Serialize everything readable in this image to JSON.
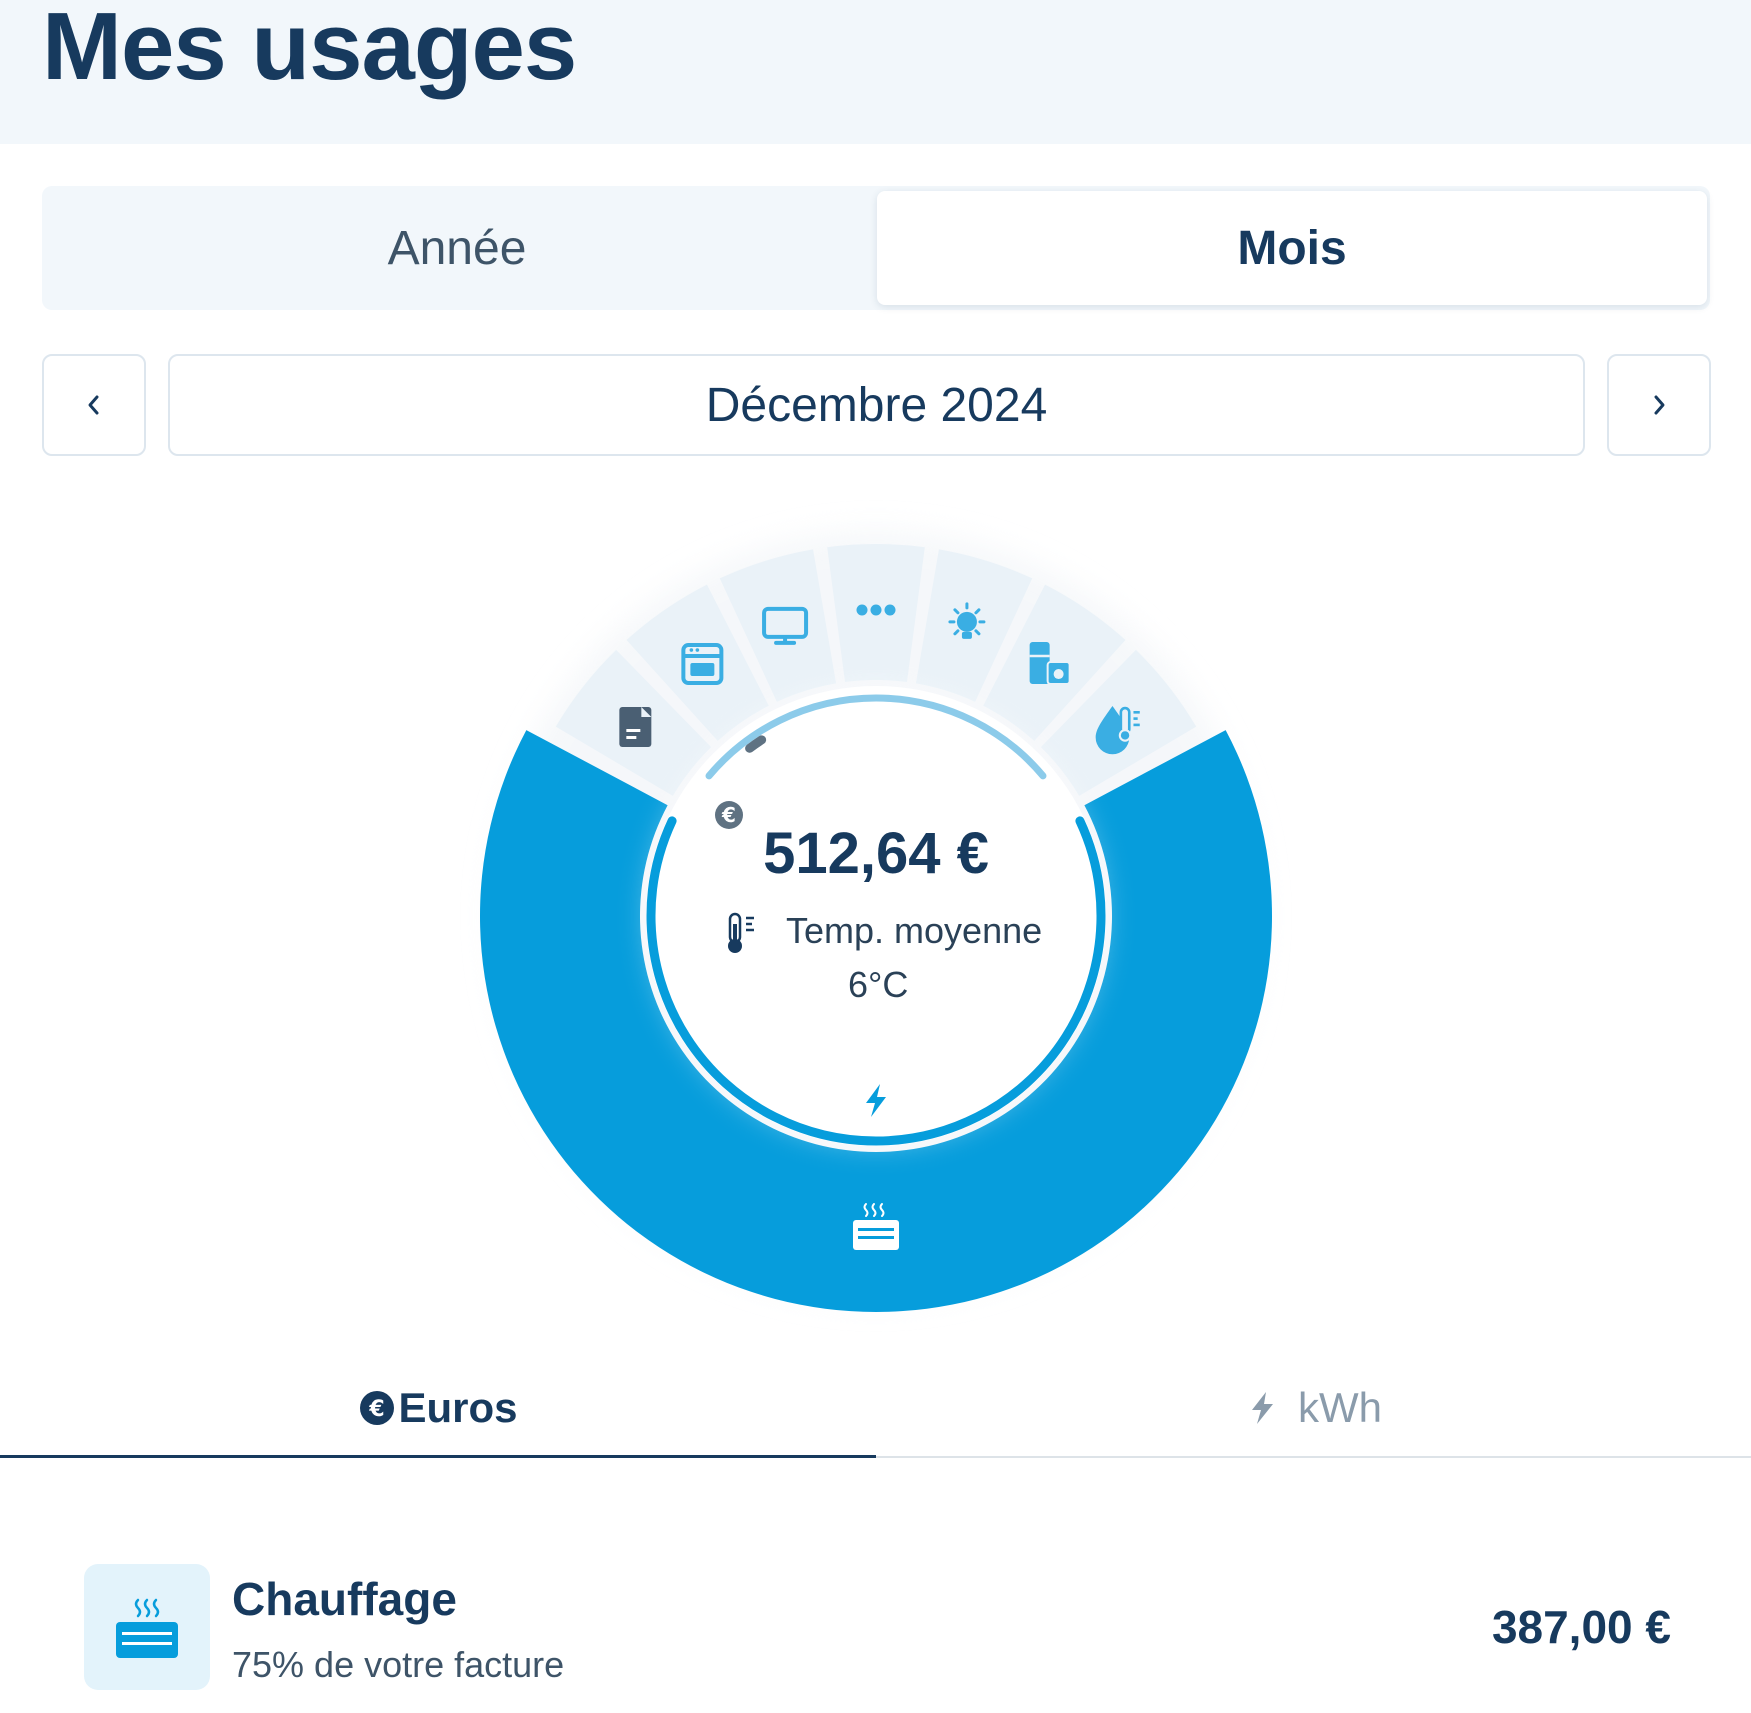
{
  "page": {
    "title": "Mes usages"
  },
  "period_tabs": [
    {
      "label": "Année",
      "selected": false
    },
    {
      "label": "Mois",
      "selected": true
    }
  ],
  "period_nav": {
    "prev_icon": "chevron-left-icon",
    "next_icon": "chevron-right-icon",
    "current": "Décembre 2024"
  },
  "summary": {
    "total": "512,64 €",
    "temp_label": "Temp. moyenne",
    "temp_value": "6°C",
    "temp_icon": "thermometer-icon",
    "energy_icon": "lightning-icon"
  },
  "usage_categories": [
    {
      "icon": "document-icon",
      "share": 0,
      "color": "#eaf2f8"
    },
    {
      "icon": "oven-icon",
      "share": 0,
      "color": "#eaf2f8"
    },
    {
      "icon": "monitor-icon",
      "share": 0,
      "color": "#eaf2f8"
    },
    {
      "icon": "more-dots-icon",
      "share": 0,
      "color": "#eaf2f8"
    },
    {
      "icon": "lightbulb-icon",
      "share": 0,
      "color": "#eaf2f8"
    },
    {
      "icon": "appliances-icon",
      "share": 0,
      "color": "#eaf2f8"
    },
    {
      "icon": "water-heater-icon",
      "share": 0,
      "color": "#eaf2f8"
    },
    {
      "icon": "heater-icon",
      "share": 75,
      "color": "#069ddc"
    }
  ],
  "unit_tabs": [
    {
      "label": "Euros",
      "icon": "euro-icon",
      "selected": true
    },
    {
      "label": "kWh",
      "icon": "lightning-icon",
      "selected": false
    }
  ],
  "breakdown": [
    {
      "icon": "heater-icon",
      "name": "Chauffage",
      "subtitle": "75% de votre facture",
      "amount": "387,00 €"
    }
  ],
  "colors": {
    "primary": "#173a5e",
    "accent": "#069ddc",
    "segment_inactive": "#eaf2f8",
    "icon_blue": "#3aaee3"
  }
}
